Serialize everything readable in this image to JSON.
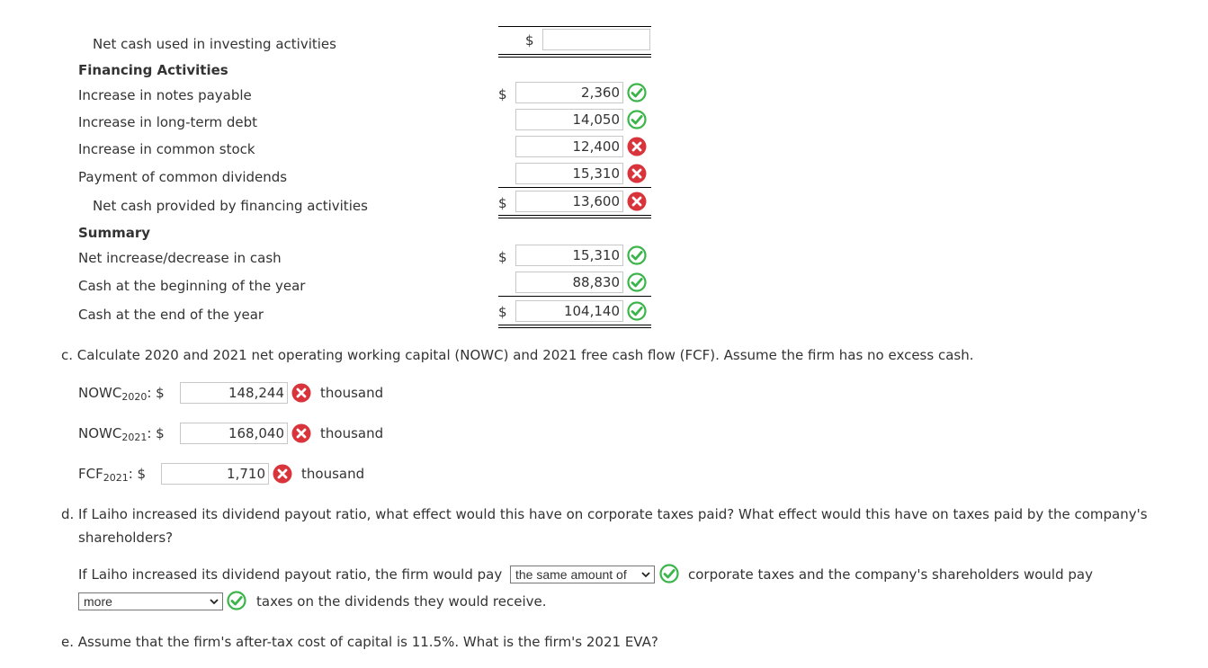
{
  "cash_flow": {
    "net_investing_label": "Net cash used in investing activities",
    "net_investing_currency": "$",
    "net_investing_value": "",
    "financing_header": "Financing Activities",
    "notes_payable_label": "Increase in notes payable",
    "notes_payable_currency": "$",
    "notes_payable_value": "2,360",
    "notes_payable_status": "correct",
    "lt_debt_label": "Increase in long-term debt",
    "lt_debt_value": "14,050",
    "lt_debt_status": "correct",
    "common_stock_label": "Increase in common stock",
    "common_stock_value": "12,400",
    "common_stock_status": "incorrect",
    "dividends_label": "Payment of common dividends",
    "dividends_value": "15,310",
    "dividends_status": "incorrect",
    "net_financing_label": "Net cash provided by financing activities",
    "net_financing_currency": "$",
    "net_financing_value": "13,600",
    "net_financing_status": "incorrect",
    "summary_header": "Summary",
    "net_change_label": "Net increase/decrease in cash",
    "net_change_currency": "$",
    "net_change_value": "15,310",
    "net_change_status": "correct",
    "cash_begin_label": "Cash at the beginning of the year",
    "cash_begin_value": "88,830",
    "cash_begin_status": "correct",
    "cash_end_label": "Cash at the end of the year",
    "cash_end_currency": "$",
    "cash_end_value": "104,140",
    "cash_end_status": "correct"
  },
  "part_c": {
    "question": "c. Calculate 2020 and 2021 net operating working capital (NOWC) and 2021 free cash flow (FCF). Assume the firm has no excess cash.",
    "nowc2020_label": "NOWC",
    "nowc2020_sub": "2020",
    "nowc2020_suffix": ": $",
    "nowc2020_value": "148,244",
    "nowc2020_unit": "thousand",
    "nowc2021_label": "NOWC",
    "nowc2021_sub": "2021",
    "nowc2021_suffix": ": $",
    "nowc2021_value": "168,040",
    "nowc2021_unit": "thousand",
    "fcf_label": "FCF",
    "fcf_sub": "2021",
    "fcf_suffix": ": $",
    "fcf_value": "1,710",
    "fcf_unit": "thousand"
  },
  "part_d": {
    "question_line1": "d. If Laiho increased its dividend payout ratio, what effect would this have on corporate taxes paid? What effect would this have on taxes paid by the company's",
    "question_line2": "shareholders?",
    "answer_prefix": "If Laiho increased its dividend payout ratio, the firm would pay",
    "select1_value": "the same amount of",
    "answer_middle": "corporate taxes and the company's shareholders would pay",
    "select2_value": "more",
    "answer_suffix": "taxes on the dividends they would receive."
  },
  "part_e": {
    "question": "e. Assume that the firm's after-tax cost of capital is 11.5%. What is the firm's 2021 EVA?"
  },
  "colors": {
    "correct": "#3bb54a",
    "incorrect": "#d9343b",
    "text": "#333333",
    "border": "#c8c8c8"
  }
}
